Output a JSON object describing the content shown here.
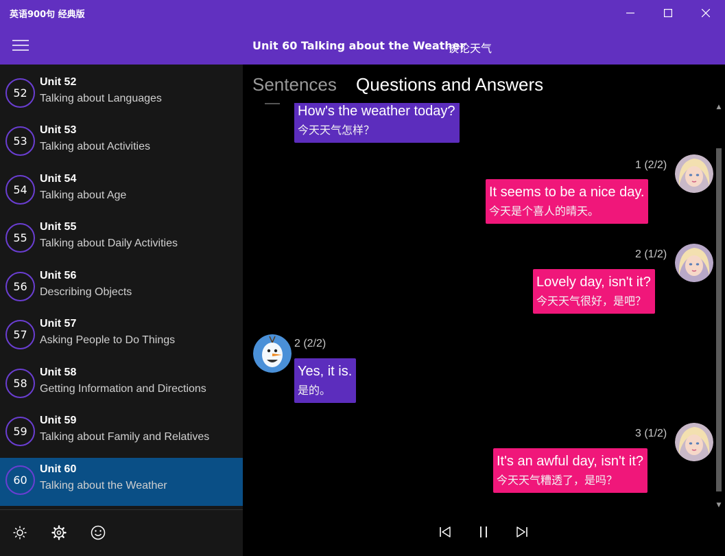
{
  "window": {
    "title": "英语900句 经典版",
    "minimize_label": "—",
    "maximize_label": "☐",
    "close_label": "✕"
  },
  "header": {
    "title": "Unit 60 Talking about the Weather",
    "title_cn": "谈论天气"
  },
  "sidebar": {
    "units": [
      {
        "num": "52",
        "name": "Unit 52",
        "desc": "Talking about Languages"
      },
      {
        "num": "53",
        "name": "Unit 53",
        "desc": "Talking about Activities"
      },
      {
        "num": "54",
        "name": "Unit 54",
        "desc": "Talking about Age"
      },
      {
        "num": "55",
        "name": "Unit 55",
        "desc": "Talking about Daily Activities"
      },
      {
        "num": "56",
        "name": "Unit 56",
        "desc": "Describing Objects"
      },
      {
        "num": "57",
        "name": "Unit 57",
        "desc": "Asking People to Do Things"
      },
      {
        "num": "58",
        "name": "Unit 58",
        "desc": "Getting Information and Directions"
      },
      {
        "num": "59",
        "name": "Unit 59",
        "desc": "Talking about Family and Relatives"
      },
      {
        "num": "60",
        "name": "Unit 60",
        "desc": "Talking about the Weather"
      }
    ],
    "selected_index": 8,
    "tools": [
      "brightness-icon",
      "gear-icon",
      "smiley-icon"
    ]
  },
  "tabs": {
    "sentences": "Sentences",
    "qa": "Questions and Answers",
    "active": "qa"
  },
  "messages": [
    {
      "side": "left",
      "meta": "",
      "en": "How's the weather today?",
      "cn": "今天天气怎样？",
      "color": "#5c2dbd"
    },
    {
      "side": "right",
      "meta": "1 (2/2)",
      "en": "It seems to be a nice day.",
      "cn": "今天是个喜人的晴天。",
      "color": "#f0177a"
    },
    {
      "side": "right",
      "meta": "2 (1/2)",
      "en": "Lovely day, isn't it?",
      "cn": "今天天气很好，是吧？",
      "color": "#f0177a"
    },
    {
      "side": "left",
      "meta": "2 (2/2)",
      "en": "Yes, it is.",
      "cn": "是的。",
      "color": "#5c2dbd"
    },
    {
      "side": "right",
      "meta": "3 (1/2)",
      "en": "It's an awful day, isn't it?",
      "cn": "今天天气糟透了，是吗？",
      "color": "#f0177a"
    }
  ],
  "player": {
    "controls": [
      "skip-previous-icon",
      "pause-icon",
      "skip-next-icon"
    ]
  },
  "colors": {
    "accent": "#6130c0",
    "selected": "#0a4f86",
    "bubble_left": "#5c2dbd",
    "bubble_right": "#f0177a"
  }
}
